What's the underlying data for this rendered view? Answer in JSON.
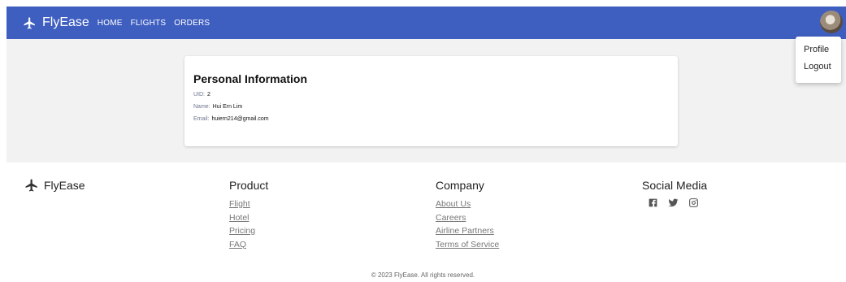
{
  "header": {
    "brand": "FlyEase",
    "nav": [
      "HOME",
      "FLIGHTS",
      "ORDERS"
    ],
    "brand_color": "#3f5fc0"
  },
  "profile_menu": {
    "items": [
      "Profile",
      "Logout"
    ]
  },
  "card": {
    "title": "Personal Information",
    "uid_label": "UID:",
    "uid_value": "2",
    "name_label": "Name:",
    "name_value": "Hui Ern Lim",
    "email_label": "Email:",
    "email_value": "huiern214@gmail.com"
  },
  "footer": {
    "brand": "FlyEase",
    "product": {
      "title": "Product",
      "links": [
        "Flight",
        "Hotel",
        "Pricing",
        "FAQ"
      ]
    },
    "company": {
      "title": "Company",
      "links": [
        "About Us",
        "Careers",
        "Airline Partners",
        "Terms of Service"
      ]
    },
    "social": {
      "title": "Social Media",
      "icons": [
        "facebook-icon",
        "twitter-icon",
        "instagram-icon"
      ]
    },
    "copyright": "© 2023 FlyEase. All rights reserved."
  }
}
